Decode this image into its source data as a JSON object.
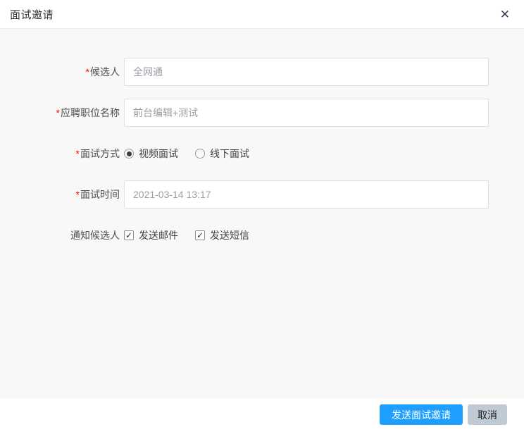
{
  "dialog": {
    "title": "面试邀请",
    "close_icon": "✕"
  },
  "form": {
    "required_mark": "*",
    "fields": {
      "candidate": {
        "label": "候选人",
        "required": true,
        "value": "全网通"
      },
      "position": {
        "label": "应聘职位名称",
        "required": true,
        "value": "前台编辑+测试"
      },
      "interview_method": {
        "label": "面试方式",
        "required": true,
        "options": [
          {
            "label": "视频面试",
            "selected": true
          },
          {
            "label": "线下面试",
            "selected": false
          }
        ]
      },
      "interview_time": {
        "label": "面试时间",
        "required": true,
        "value": "2021-03-14 13:17"
      },
      "notify_candidate": {
        "label": "通知候选人",
        "required": false,
        "options": [
          {
            "label": "发送邮件",
            "checked": true
          },
          {
            "label": "发送短信",
            "checked": true
          }
        ]
      }
    }
  },
  "footer": {
    "send_label": "发送面试邀请",
    "cancel_label": "取消"
  },
  "colors": {
    "primary_button": "#1e9fff",
    "cancel_button": "#c0cad4",
    "required_mark": "#ff0000",
    "body_background": "#f8f8f9"
  }
}
